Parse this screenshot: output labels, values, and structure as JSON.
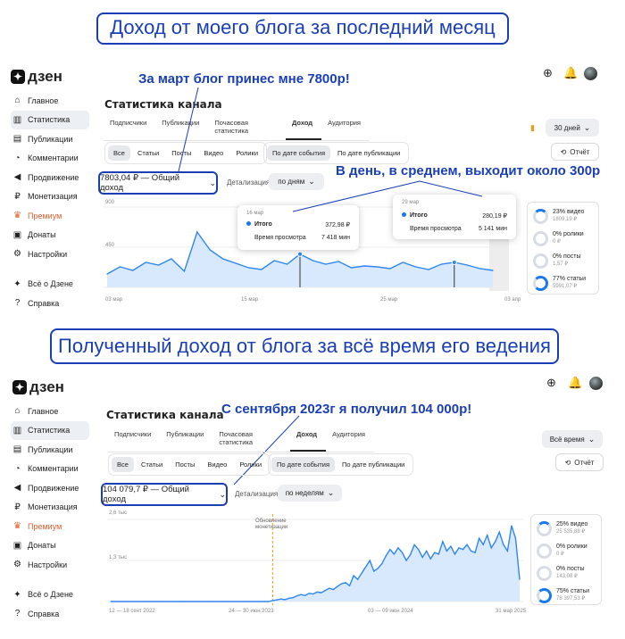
{
  "banner_top": "Доход от моего блога за последний месяц",
  "banner_mid": "Полученный доход от блога за всё время его ведения",
  "brand": "дзен",
  "sidebar": {
    "items": [
      {
        "label": "Главное",
        "icon": "home-icon"
      },
      {
        "label": "Статистика",
        "icon": "chart-icon"
      },
      {
        "label": "Публикации",
        "icon": "pages-icon"
      },
      {
        "label": "Комментарии",
        "icon": "comment-icon"
      },
      {
        "label": "Продвижение",
        "icon": "megaphone-icon"
      },
      {
        "label": "Монетизация",
        "icon": "ruble-icon"
      },
      {
        "label": "Премиум",
        "icon": "crown-icon"
      },
      {
        "label": "Донаты",
        "icon": "gift-icon"
      },
      {
        "label": "Настройки",
        "icon": "gear-icon"
      }
    ],
    "footer": [
      {
        "label": "Всё о Дзене",
        "icon": "dzen-icon"
      },
      {
        "label": "Справка",
        "icon": "help-icon"
      }
    ]
  },
  "header_icons": [
    "add-icon",
    "bell-icon",
    "avatar"
  ],
  "panel1": {
    "callout": "За март блог принес мне 7800р!",
    "callout2": "В день, в среднем, выходит около 300р",
    "title": "Статистика канала",
    "tabs": [
      "Подписчики",
      "Публикации",
      "Почасовая статистика",
      "Доход",
      "Аудитория"
    ],
    "active_tab": "Доход",
    "period": "30 дней",
    "types": [
      "Все",
      "Статьи",
      "Посты",
      "Видео",
      "Ролики"
    ],
    "sort": [
      "По дате события",
      "По дате публикации"
    ],
    "report": "Отчёт",
    "income": "7803,04 ₽ — Общий доход",
    "detail_label": "Детализация",
    "detail_value": "по дням",
    "y_ticks": [
      "900",
      "450",
      "0"
    ],
    "x_ticks": [
      "03 мар",
      "15 мар",
      "25 мар",
      "03 апр"
    ],
    "tooltips": [
      {
        "date": "16 мар",
        "label": "Итого",
        "value": "372,98 ₽",
        "label2": "Время просмотра",
        "value2": "7 418 мин"
      },
      {
        "date": "29 мар",
        "label": "Итого",
        "value": "280,19 ₽",
        "label2": "Время просмотра",
        "value2": "5 141 мин"
      }
    ],
    "legend": [
      {
        "pct": "23% видео",
        "amt": "1809,19 ₽"
      },
      {
        "pct": "0% ролики",
        "amt": "0 ₽"
      },
      {
        "pct": "0% посты",
        "amt": "1,57 ₽"
      },
      {
        "pct": "77% статьи",
        "amt": "5991,07 ₽"
      }
    ]
  },
  "panel2": {
    "callout": "С сентября 2023г я получил 104 000р!",
    "title": "Статистика канала",
    "tabs": [
      "Подписчики",
      "Публикации",
      "Почасовая статистика",
      "Доход",
      "Аудитория"
    ],
    "active_tab": "Доход",
    "period": "Всё время",
    "types": [
      "Все",
      "Статьи",
      "Посты",
      "Видео",
      "Ролики"
    ],
    "sort": [
      "По дате события",
      "По дате публикации"
    ],
    "report": "Отчёт",
    "income": "104 079,7 ₽ — Общий доход",
    "detail_label": "Детализация",
    "detail_value": "по неделям",
    "y_ticks": [
      "2,6 тыс",
      "1,3 тыс",
      "0"
    ],
    "x_ticks": [
      "12 — 18 сент 2022",
      "24 — 30 июн 2023",
      "03 — 09 июн 2024",
      "31 мар 2025"
    ],
    "annotation": "Обновление монетизации",
    "legend": [
      {
        "pct": "25% видео",
        "amt": "25 535,88 ₽"
      },
      {
        "pct": "0% ролики",
        "amt": "0 ₽"
      },
      {
        "pct": "0% посты",
        "amt": "143,08 ₽"
      },
      {
        "pct": "75% статьи",
        "amt": "78 397,53 ₽"
      }
    ]
  },
  "chart_data": [
    {
      "type": "area",
      "title": "",
      "x_range": [
        "03 мар",
        "03 апр"
      ],
      "ylim": [
        0,
        900
      ],
      "series": [
        {
          "values": [
            150,
            230,
            190,
            280,
            250,
            320,
            180,
            620,
            420,
            320,
            270,
            220,
            200,
            300,
            260,
            372.98,
            300,
            260,
            290,
            220,
            240,
            230,
            210,
            280,
            230,
            200,
            260,
            280.19,
            250,
            210,
            190
          ]
        }
      ]
    },
    {
      "type": "area",
      "title": "",
      "x_range": [
        "12 — 18 сент 2022",
        "31 мар 2025"
      ],
      "ylim": [
        0,
        2600
      ],
      "series": [
        {
          "values": [
            0,
            0,
            0,
            0,
            0,
            0,
            0,
            0,
            0,
            0,
            0,
            0,
            0,
            0,
            0,
            0,
            0,
            0,
            0,
            0,
            0,
            0,
            0,
            0,
            0,
            0,
            0,
            0,
            0,
            0,
            0,
            0,
            0,
            0,
            0,
            0,
            0,
            0,
            0,
            0,
            30,
            50,
            80,
            60,
            100,
            120,
            180,
            220,
            190,
            260,
            240,
            300,
            280,
            350,
            420,
            380,
            480,
            560,
            600,
            500,
            820,
            700,
            900,
            1100,
            1300,
            960,
            1050,
            1200,
            1450,
            1650,
            1500,
            1700,
            1550,
            1300,
            1480,
            1800,
            1650,
            1400,
            1600,
            1350,
            1550,
            1500,
            1900,
            1600,
            1750,
            1500,
            1700,
            1650,
            1800,
            1600,
            1550,
            2000,
            1800,
            2100,
            1700,
            1900,
            2200,
            1800,
            1600,
            2400,
            2000,
            700
          ]
        }
      ]
    }
  ]
}
